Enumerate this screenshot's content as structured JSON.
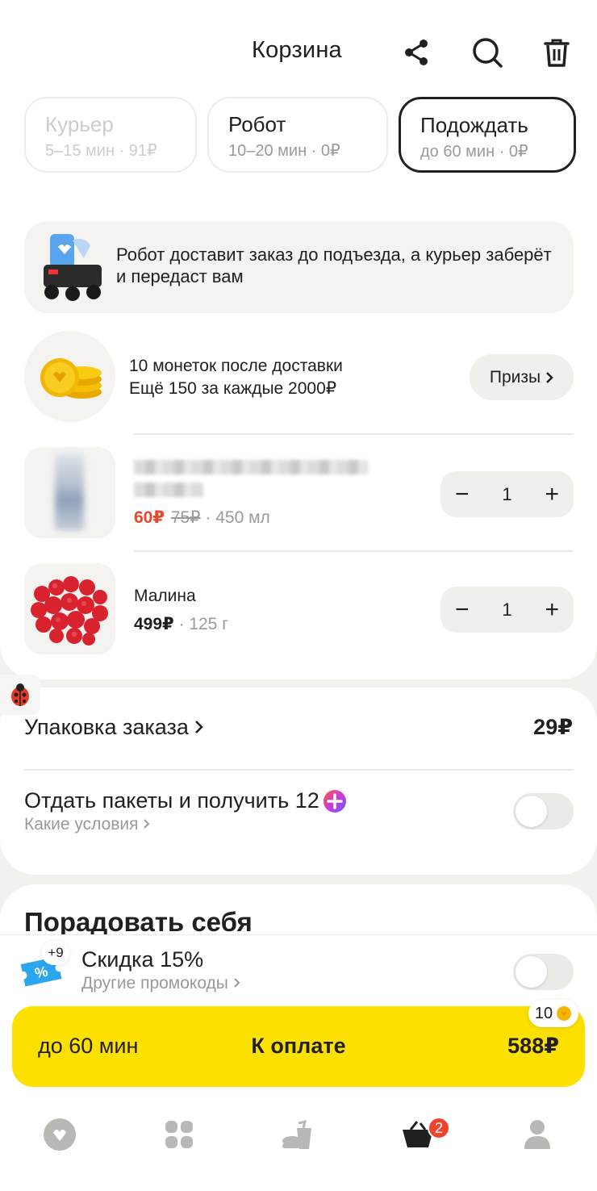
{
  "header": {
    "title": "Корзина"
  },
  "delivery_options": [
    {
      "title": "Курьер",
      "subtitle": "5–15 мин · 91₽",
      "state": "disabled"
    },
    {
      "title": "Робот",
      "subtitle": "10–20 мин · 0₽",
      "state": "normal"
    },
    {
      "title": "Подождать",
      "subtitle": "до 60 мин · 0₽",
      "state": "selected"
    }
  ],
  "robot_banner": {
    "text": "Робот доставит заказ до подъезда, а курьер заберёт и передаст вам"
  },
  "coins": {
    "line1": "10 монеток после доставки",
    "line2": "Ещё 150 за каждые 2000₽",
    "prizes_label": "Призы"
  },
  "products": [
    {
      "name": "",
      "new_price": "60₽",
      "old_price": "75₽",
      "meta": "· 450 мл",
      "qty": "1"
    },
    {
      "name": "Малина",
      "price": "499₽",
      "meta": "· 125 г",
      "qty": "1"
    }
  ],
  "stepper": {
    "minus": "−",
    "plus": "+"
  },
  "packaging": {
    "label": "Упаковка заказа",
    "price": "29₽"
  },
  "bags": {
    "label": "Отдать пакеты и получить 12",
    "sub": "Какие условия",
    "toggle_on": false
  },
  "treat": {
    "title": "Порадовать себя"
  },
  "promo": {
    "count": "+9",
    "title": "Скидка 15%",
    "sub": "Другие промокоды",
    "toggle_on": false
  },
  "pay": {
    "time": "до 60 мин",
    "label": "К оплате",
    "total": "588₽",
    "coins": "10"
  },
  "tabbar": {
    "cart_badge": "2"
  },
  "colors": {
    "accent_yellow": "#fce000",
    "discount_red": "#e8472a",
    "badge_red": "#f0452c"
  }
}
